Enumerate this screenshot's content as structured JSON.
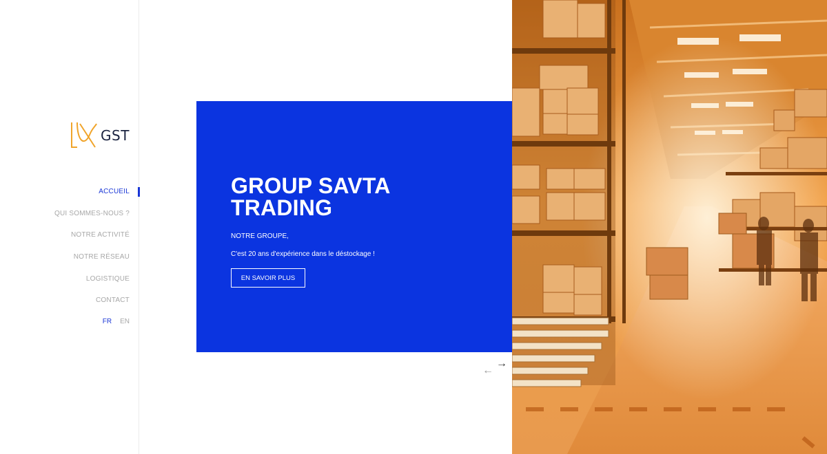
{
  "logo": {
    "text": "GST",
    "icon": "gst-logo-icon",
    "accent": "#f0a42a"
  },
  "nav": {
    "items": [
      {
        "label": "ACCUEIL",
        "active": true
      },
      {
        "label": "QUI SOMMES-NOUS ?"
      },
      {
        "label": "NOTRE ACTIVITÉ"
      },
      {
        "label": "NOTRE RÉSEAU"
      },
      {
        "label": "LOGISTIQUE"
      },
      {
        "label": "CONTACT"
      }
    ],
    "languages": [
      {
        "label": "FR",
        "active": true
      },
      {
        "label": "EN"
      }
    ]
  },
  "hero": {
    "title": "GROUP SAVTA TRADING",
    "subtitle": "NOTRE GROUPE,",
    "text": "C'est 20 ans d'expérience dans le déstockage !",
    "button_label": "EN SAVOIR PLUS",
    "background": "#0b34e0"
  },
  "slider": {
    "prev_icon": "arrow-left-icon",
    "next_icon": "arrow-right-icon",
    "prev_glyph": "←",
    "next_glyph": "→"
  },
  "colors": {
    "accent": "#1936d6",
    "muted": "#a7a7a7",
    "photo_tint": "#e8922e"
  }
}
